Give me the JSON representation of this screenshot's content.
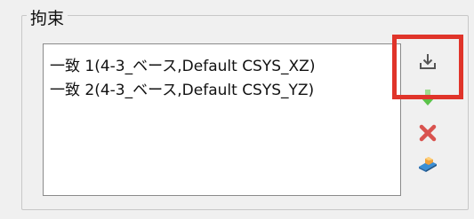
{
  "group": {
    "title": "拘束"
  },
  "constraints": [
    {
      "label": "一致 1(4-3_ベース,Default CSYS_XZ)"
    },
    {
      "label": "一致 2(4-3_ベース,Default CSYS_YZ)"
    }
  ],
  "toolbar": {
    "buttons": [
      {
        "icon": "import-icon"
      },
      {
        "icon": "move-down-arrow-icon"
      },
      {
        "icon": "delete-x-icon"
      },
      {
        "icon": "assembly-icon"
      }
    ]
  },
  "colors": {
    "highlight": "#e0342a",
    "delete": "#d9534f",
    "arrow": "#5cc24a"
  }
}
